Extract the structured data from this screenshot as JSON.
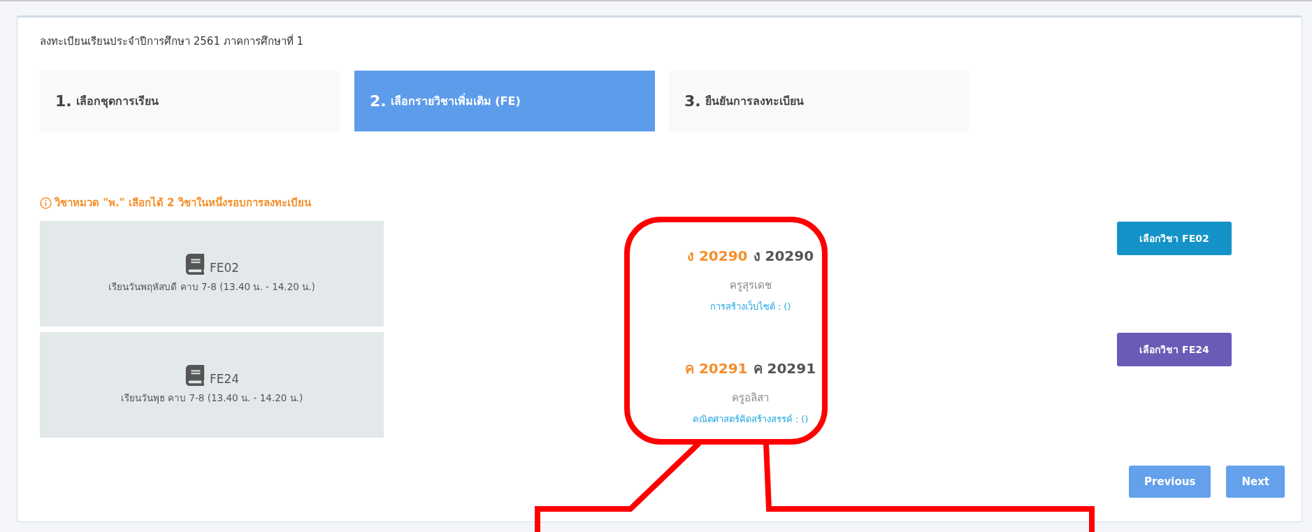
{
  "panel_title": "ลงทะเบียนเรียนประจำปีการศึกษา 2561 ภาคการศึกษาที่ 1",
  "steps": [
    {
      "number": "1.",
      "label": "เลือกชุดการเรียน",
      "selected": false
    },
    {
      "number": "2.",
      "label": "เลือกรายวิชาเพิ่มเติม (FE)",
      "selected": true
    },
    {
      "number": "3.",
      "label": "ยืนยันการลงทะเบียน",
      "selected": false
    }
  ],
  "notice": "วิชาหมวด \"พ.\" เลือกได้ 2 วิชาในหนึ่งรอบการลงทะเบียน",
  "courses": [
    {
      "slot": "FE02",
      "schedule": "เรียนวันพฤหัสบดี คาบ 7-8 (13.40 น. - 14.20 น.)",
      "code": "ง 20290",
      "code_name": "ง 20290",
      "teacher": "ครูสุรเดช",
      "subject": "การสร้างเว็บไซต์ : ()",
      "button": "เลือกวิชา FE02",
      "color": "#1493c8"
    },
    {
      "slot": "FE24",
      "schedule": "เรียนวันพุธ คาบ 7-8 (13.40 น. - 14.20 น.)",
      "code": "ค 20291",
      "code_name": "ค 20291",
      "teacher": "ครูอลิสา",
      "subject": "คณิตศาสตร์คิดสร้างสรรค์ : ()",
      "button": "เลือกวิชา FE24",
      "color": "#6a5bb7"
    }
  ],
  "nav": {
    "previous": "Previous",
    "next": "Next"
  }
}
